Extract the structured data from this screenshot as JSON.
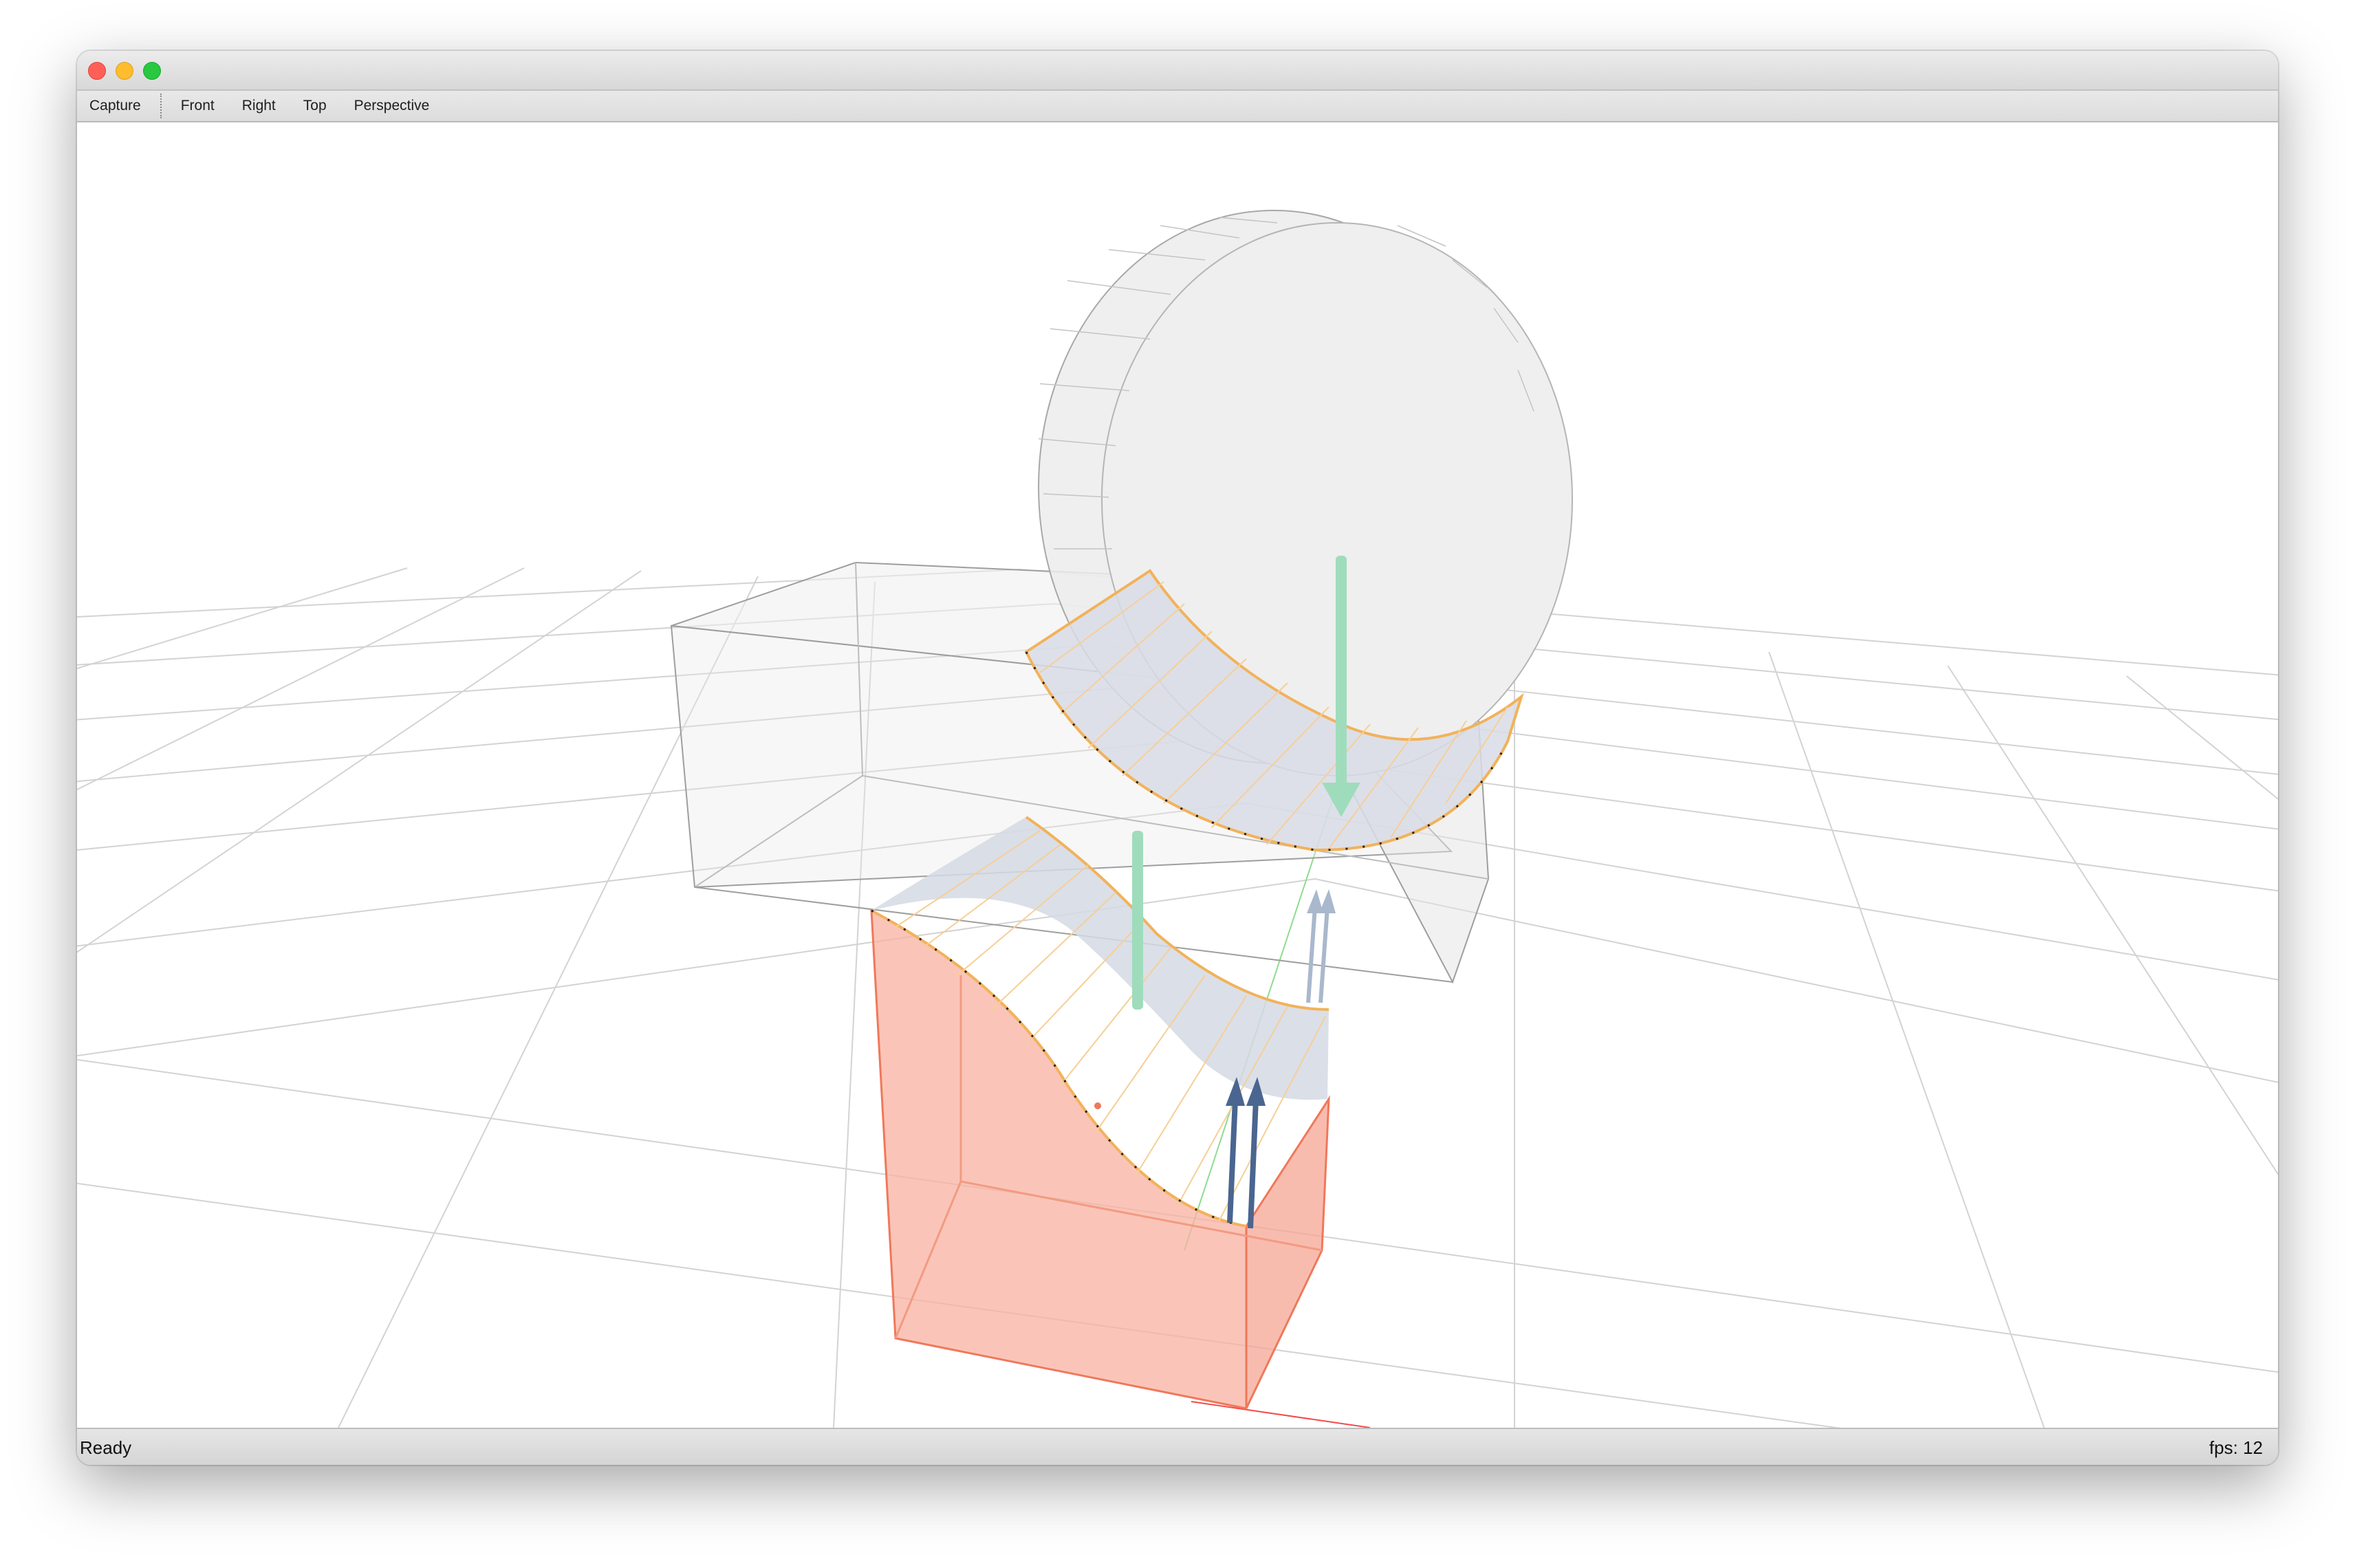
{
  "toolbar": {
    "capture": "Capture",
    "front": "Front",
    "right": "Right",
    "top": "Top",
    "perspective": "Perspective"
  },
  "status": {
    "message": "Ready",
    "fps": "fps: 12"
  },
  "colors": {
    "roller": "#eeeeee",
    "box": "#f2f2f2",
    "solid": "#f8b1a0",
    "solid_edge": "#f0785a",
    "contact_fill": "#d7dbe3",
    "contact_edge": "#f2b25a",
    "force_arrow": "#9fdcbc",
    "normal_arrow": "#4a6590",
    "grid": "#d0d0d0"
  },
  "icons": {
    "close": "close-icon",
    "minimize": "minimize-icon",
    "zoom": "zoom-icon"
  }
}
